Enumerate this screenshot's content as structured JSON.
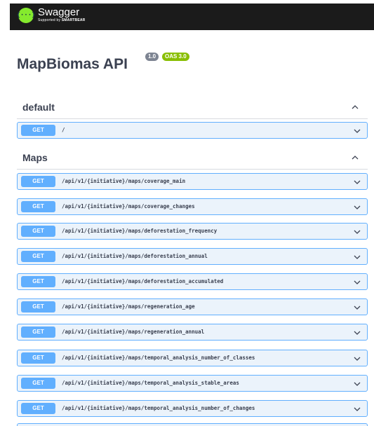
{
  "header": {
    "logo_icon": "swagger-logo-icon",
    "logo_glyph": "{···}",
    "brand_name": "Swagger",
    "brand_sub_prefix": "Supported by ",
    "brand_sub_strong": "SMARTBEAR"
  },
  "info": {
    "title": "MapBiomas API",
    "version": "1.0",
    "oas": "OAS 3.0"
  },
  "tags": [
    {
      "name": "default",
      "expanded": true,
      "operations": [
        {
          "method": "GET",
          "path": "/"
        }
      ]
    },
    {
      "name": "Maps",
      "expanded": true,
      "operations": [
        {
          "method": "GET",
          "path": "/api/v1/{initiative}/maps/coverage_main"
        },
        {
          "method": "GET",
          "path": "/api/v1/{initiative}/maps/coverage_changes"
        },
        {
          "method": "GET",
          "path": "/api/v1/{initiative}/maps/deforestation_frequency"
        },
        {
          "method": "GET",
          "path": "/api/v1/{initiative}/maps/deforestation_annual"
        },
        {
          "method": "GET",
          "path": "/api/v1/{initiative}/maps/deforestation_accumulated"
        },
        {
          "method": "GET",
          "path": "/api/v1/{initiative}/maps/regeneration_age"
        },
        {
          "method": "GET",
          "path": "/api/v1/{initiative}/maps/regeneration_annual"
        },
        {
          "method": "GET",
          "path": "/api/v1/{initiative}/maps/temporal_analysis_number_of_classes"
        },
        {
          "method": "GET",
          "path": "/api/v1/{initiative}/maps/temporal_analysis_stable_areas"
        },
        {
          "method": "GET",
          "path": "/api/v1/{initiative}/maps/temporal_analysis_number_of_changes"
        }
      ]
    }
  ],
  "colors": {
    "get_accent": "#61affe",
    "get_background": "#ebf3fb",
    "topbar": "#1b1b1b",
    "logo_green": "#85ea2d",
    "oas_badge": "#89bf04",
    "version_badge": "#7d8492"
  }
}
